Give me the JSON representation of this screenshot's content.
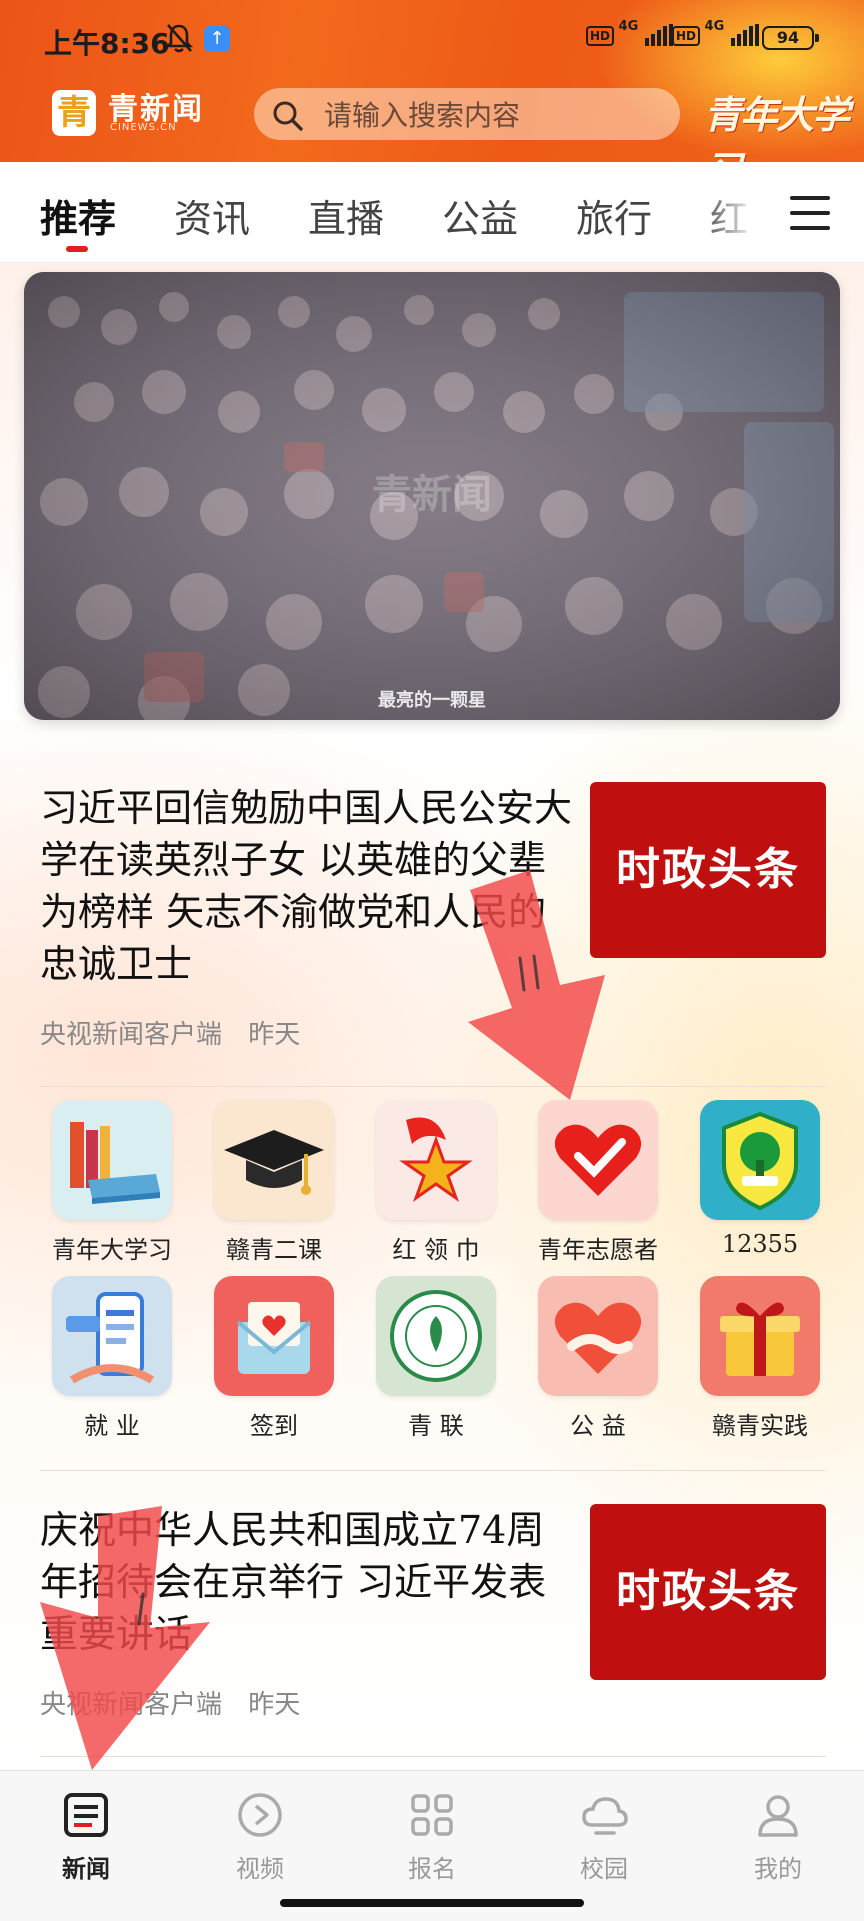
{
  "status_bar": {
    "time": "上午8:36",
    "signal1": "4G",
    "signal2": "4G",
    "hd": "HD",
    "battery": "94"
  },
  "header": {
    "logo_char": "青",
    "logo_text": "青新闻",
    "logo_sub": "CINEWS.CN",
    "search_placeholder": "请输入搜索内容",
    "slogan": "青年大学习"
  },
  "tabs": [
    {
      "label": "推荐",
      "active": true
    },
    {
      "label": "资讯"
    },
    {
      "label": "直播"
    },
    {
      "label": "公益"
    },
    {
      "label": "旅行"
    },
    {
      "label": "红"
    }
  ],
  "banner": {
    "watermark": "青新闻",
    "caption": "最亮的一颗星"
  },
  "news": [
    {
      "title": "习近平回信勉励中国人民公安大学在读英烈子女 以英雄的父辈为榜样 矢志不渝做党和人民的忠诚卫士",
      "source": "央视新闻客户端",
      "time": "昨天",
      "thumb": "时政头条"
    },
    {
      "title": "庆祝中华人民共和国成立74周年招待会在京举行 习近平发表重要讲话",
      "source": "央视新闻客户端",
      "time": "昨天",
      "thumb": "时政头条"
    }
  ],
  "grid": [
    {
      "label": "青年大学习",
      "icon": "books-icon",
      "bg": "#d8eef0"
    },
    {
      "label": "赣青二课",
      "icon": "graduation-cap-icon",
      "bg": "#fbe6cf"
    },
    {
      "label": "红 领 巾",
      "icon": "red-scarf-star-icon",
      "bg": "#fbe9e6"
    },
    {
      "label": "青年志愿者",
      "icon": "volunteer-heart-icon",
      "bg": "#fcd6cf"
    },
    {
      "label": "12355",
      "icon": "tree-badge-icon",
      "bg": "#2fb0c8"
    },
    {
      "label": "就 业",
      "icon": "phone-resume-icon",
      "bg": "#cfe0ee"
    },
    {
      "label": "签到",
      "icon": "envelope-heart-icon",
      "bg": "#f0605c"
    },
    {
      "label": "青 联",
      "icon": "youth-federation-seal-icon",
      "bg": "#d6e4d2"
    },
    {
      "label": "公 益",
      "icon": "handshake-heart-icon",
      "bg": "#f8bdb0"
    },
    {
      "label": "赣青实践",
      "icon": "gift-box-icon",
      "bg": "#f27a6a"
    }
  ],
  "bottom_nav": [
    {
      "label": "新闻",
      "icon": "news-icon",
      "active": true
    },
    {
      "label": "视频",
      "icon": "video-play-icon"
    },
    {
      "label": "报名",
      "icon": "grid-apps-icon"
    },
    {
      "label": "校园",
      "icon": "cloud-icon"
    },
    {
      "label": "我的",
      "icon": "user-icon"
    }
  ],
  "colors": {
    "header_orange": "#ec5418",
    "headline_red": "#c00f0f",
    "tab_indicator": "#e02020",
    "annotation_arrow": "#f24848"
  }
}
